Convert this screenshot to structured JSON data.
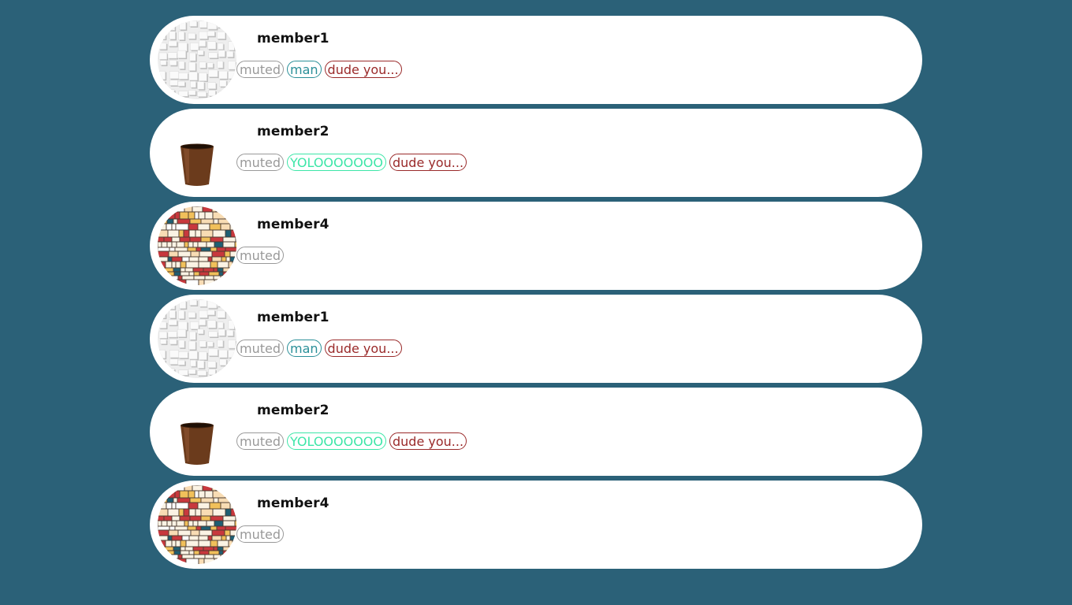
{
  "colors": {
    "background": "#2b6178",
    "card": "#ffffff",
    "muted": "#999999",
    "teal": "#2a8f98",
    "mint": "#3de6a8",
    "maroon": "#9a2a2a"
  },
  "members": [
    {
      "name": "member1",
      "avatar": "crumpled-paper-avatar",
      "tags": [
        {
          "label": "muted",
          "color": "#999999"
        },
        {
          "label": "man",
          "color": "#2a8f98"
        },
        {
          "label": "dude you...",
          "color": "#9a2a2a"
        }
      ]
    },
    {
      "name": "member2",
      "avatar": "flower-pot-avatar",
      "tags": [
        {
          "label": "muted",
          "color": "#999999"
        },
        {
          "label": "YOLOOOOOOO",
          "color": "#3de6a8"
        },
        {
          "label": "dude you...",
          "color": "#9a2a2a"
        }
      ]
    },
    {
      "name": "member4",
      "avatar": "mondrian-pattern-avatar",
      "tags": [
        {
          "label": "muted",
          "color": "#999999"
        }
      ]
    },
    {
      "name": "member1",
      "avatar": "crumpled-paper-avatar",
      "tags": [
        {
          "label": "muted",
          "color": "#999999"
        },
        {
          "label": "man",
          "color": "#2a8f98"
        },
        {
          "label": "dude you...",
          "color": "#9a2a2a"
        }
      ]
    },
    {
      "name": "member2",
      "avatar": "flower-pot-avatar",
      "tags": [
        {
          "label": "muted",
          "color": "#999999"
        },
        {
          "label": "YOLOOOOOOO",
          "color": "#3de6a8"
        },
        {
          "label": "dude you...",
          "color": "#9a2a2a"
        }
      ]
    },
    {
      "name": "member4",
      "avatar": "mondrian-pattern-avatar",
      "tags": [
        {
          "label": "muted",
          "color": "#999999"
        }
      ]
    }
  ]
}
